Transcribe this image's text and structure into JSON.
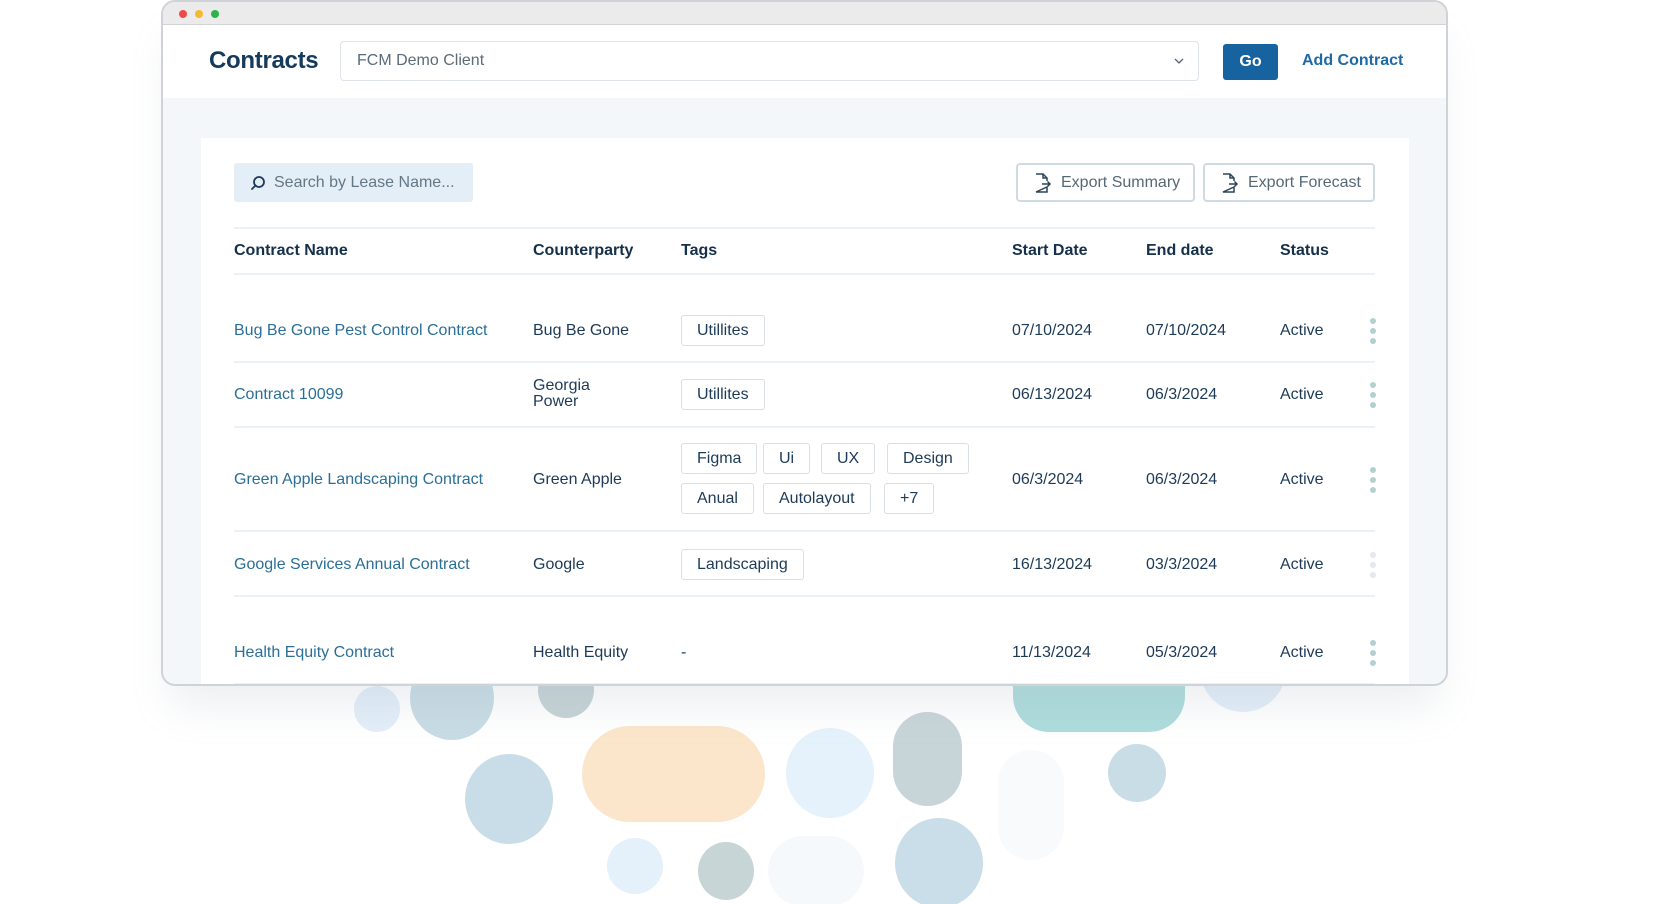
{
  "window": {
    "controls": [
      "close",
      "minimize",
      "maximize"
    ]
  },
  "header": {
    "title": "Contracts",
    "client_select": {
      "value": "FCM Demo Client",
      "icon": "chevron-down-icon"
    },
    "go_label": "Go",
    "add_contract_label": "Add Contract"
  },
  "toolbar": {
    "search_placeholder": "Search by Lease Name...",
    "export_summary_label": "Export Summary",
    "export_forecast_label": "Export Forecast"
  },
  "table": {
    "columns": [
      "Contract Name",
      "Counterparty",
      "Tags",
      "Start Date",
      "End date",
      "Status"
    ],
    "rows": [
      {
        "name": "Bug Be Gone Pest Control Contract",
        "counterparty": "Bug Be Gone",
        "tags": [
          "Utillites"
        ],
        "start": "07/10/2024",
        "end": "07/10/2024",
        "status": "Active"
      },
      {
        "name": "Contract 10099",
        "counterparty": "Georgia Power",
        "tags": [
          "Utillites"
        ],
        "start": "06/13/2024",
        "end": "06/3/2024",
        "status": "Active"
      },
      {
        "name": "Green Apple Landscaping Contract",
        "counterparty": "Green Apple",
        "tags": [
          "Figma",
          "Ui",
          "UX",
          "Design",
          "Anual",
          "Autolayout",
          "+7"
        ],
        "start": "06/3/2024",
        "end": "06/3/2024",
        "status": "Active"
      },
      {
        "name": "Google Services Annual Contract",
        "counterparty": "Google",
        "tags": [
          "Landscaping"
        ],
        "start": "16/13/2024",
        "end": "03/3/2024",
        "status": "Active"
      },
      {
        "name": "Health Equity Contract",
        "counterparty": "Health Equity",
        "tags_placeholder": "-",
        "start": "11/13/2024",
        "end": "05/3/2024",
        "status": "Active"
      }
    ]
  },
  "colors": {
    "primary": "#17639f",
    "link": "#2b6f97",
    "heading": "#143a5c",
    "search_bg": "#e4eef7",
    "kebab": "#b4cfd0"
  }
}
